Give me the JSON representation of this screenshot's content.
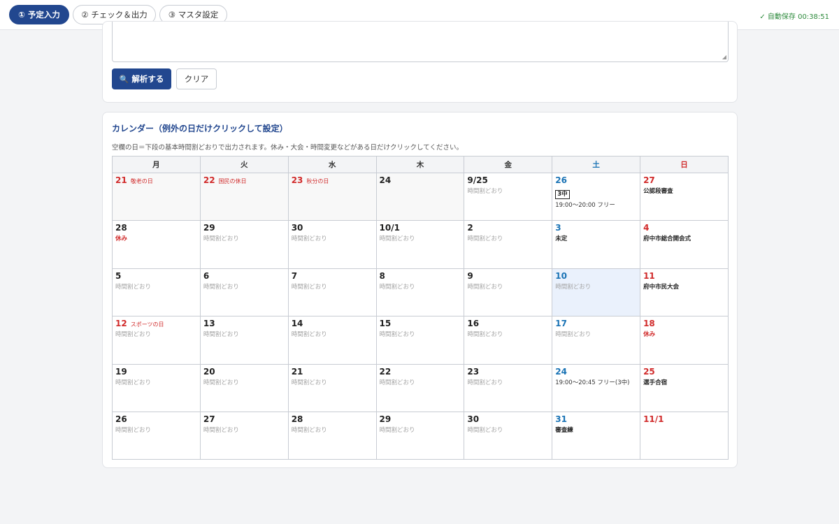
{
  "tabs": [
    {
      "label": "① 予定入力",
      "active": true
    },
    {
      "label": "② チェック＆出力",
      "active": false
    },
    {
      "label": "③ マスタ設定",
      "active": false
    }
  ],
  "autosave": "✓ 自動保存 00:38:51",
  "input_card": {
    "analyze_icon": "🔍",
    "analyze_label": "解析する",
    "clear_label": "クリア"
  },
  "calendar": {
    "title": "カレンダー（例外の日だけクリックして設定）",
    "note": "空欄の日＝下段の基本時間割どおりで出力されます。休み・大会・時間変更などがある日だけクリックしてください。",
    "weekdays": [
      "月",
      "火",
      "水",
      "木",
      "金",
      "土",
      "日"
    ],
    "weeks": [
      [
        {
          "day": "21",
          "holiday": "敬老の日",
          "past": true
        },
        {
          "day": "22",
          "holiday": "国民の休日",
          "past": true
        },
        {
          "day": "23",
          "holiday": "秋分の日",
          "past": true
        },
        {
          "day": "24",
          "past": true
        },
        {
          "day": "9/25",
          "sub": "時間割どおり",
          "sub_type": "default"
        },
        {
          "day": "26",
          "badge": "3中",
          "sub": "19:00〜20:00 フリー",
          "sub_type": "plain"
        },
        {
          "day": "27",
          "sub": "公認段審査",
          "sub_type": "event"
        }
      ],
      [
        {
          "day": "28",
          "sub": "休み",
          "sub_type": "off"
        },
        {
          "day": "29",
          "sub": "時間割どおり",
          "sub_type": "default"
        },
        {
          "day": "30",
          "sub": "時間割どおり",
          "sub_type": "default"
        },
        {
          "day": "10/1",
          "sub": "時間割どおり",
          "sub_type": "default"
        },
        {
          "day": "2",
          "sub": "時間割どおり",
          "sub_type": "default"
        },
        {
          "day": "3",
          "sub": "未定",
          "sub_type": "event"
        },
        {
          "day": "4",
          "sub": "府中市総合開会式",
          "sub_type": "event"
        }
      ],
      [
        {
          "day": "5",
          "sub": "時間割どおり",
          "sub_type": "default"
        },
        {
          "day": "6",
          "sub": "時間割どおり",
          "sub_type": "default"
        },
        {
          "day": "7",
          "sub": "時間割どおり",
          "sub_type": "default"
        },
        {
          "day": "8",
          "sub": "時間割どおり",
          "sub_type": "default"
        },
        {
          "day": "9",
          "sub": "時間割どおり",
          "sub_type": "default"
        },
        {
          "day": "10",
          "sub": "時間割どおり",
          "sub_type": "default",
          "today": true
        },
        {
          "day": "11",
          "sub": "府中市民大会",
          "sub_type": "event"
        }
      ],
      [
        {
          "day": "12",
          "holiday": "スポーツの日",
          "sub": "時間割どおり",
          "sub_type": "default"
        },
        {
          "day": "13",
          "sub": "時間割どおり",
          "sub_type": "default"
        },
        {
          "day": "14",
          "sub": "時間割どおり",
          "sub_type": "default"
        },
        {
          "day": "15",
          "sub": "時間割どおり",
          "sub_type": "default"
        },
        {
          "day": "16",
          "sub": "時間割どおり",
          "sub_type": "default"
        },
        {
          "day": "17",
          "sub": "時間割どおり",
          "sub_type": "default"
        },
        {
          "day": "18",
          "sub": "休み",
          "sub_type": "off"
        }
      ],
      [
        {
          "day": "19",
          "sub": "時間割どおり",
          "sub_type": "default"
        },
        {
          "day": "20",
          "sub": "時間割どおり",
          "sub_type": "default"
        },
        {
          "day": "21",
          "sub": "時間割どおり",
          "sub_type": "default"
        },
        {
          "day": "22",
          "sub": "時間割どおり",
          "sub_type": "default"
        },
        {
          "day": "23",
          "sub": "時間割どおり",
          "sub_type": "default"
        },
        {
          "day": "24",
          "sub": "19:00〜20:45 フリー(3中)",
          "sub_type": "plain"
        },
        {
          "day": "25",
          "sub": "選手合宿",
          "sub_type": "event"
        }
      ],
      [
        {
          "day": "26",
          "sub": "時間割どおり",
          "sub_type": "default"
        },
        {
          "day": "27",
          "sub": "時間割どおり",
          "sub_type": "default"
        },
        {
          "day": "28",
          "sub": "時間割どおり",
          "sub_type": "default"
        },
        {
          "day": "29",
          "sub": "時間割どおり",
          "sub_type": "default"
        },
        {
          "day": "30",
          "sub": "時間割どおり",
          "sub_type": "default"
        },
        {
          "day": "31",
          "sub": "審査練",
          "sub_type": "event"
        },
        {
          "day": "11/1"
        }
      ]
    ]
  },
  "colors": {
    "primary": "#22478f",
    "saturday": "#1a73b5",
    "sunday_holiday": "#d12b2b",
    "autosave": "#2e8b3d",
    "today_bg": "#eaf1fc"
  }
}
